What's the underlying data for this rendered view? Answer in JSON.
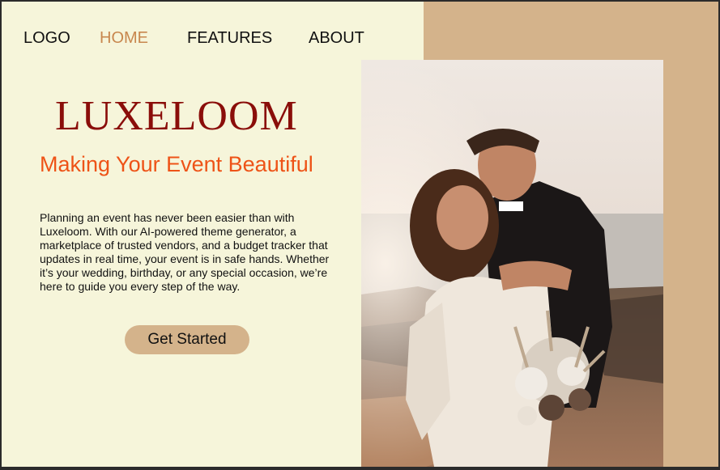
{
  "nav": {
    "logo": "LOGO",
    "items": [
      "HOME",
      "FEATURES",
      "ABOUT"
    ],
    "active": "HOME"
  },
  "hero": {
    "brand": "LUXELOOM",
    "tagline": "Making Your Event Beautiful",
    "description": "Planning an event has never been easier than with Luxeloom. With our AI-powered theme generator, a marketplace of trusted vendors, and a budget tracker that updates in real time, your event is in safe hands. Whether it’s your wedding, birthday, or any special occasion, we’re here to guide you every step of the way.",
    "cta_label": "Get Started"
  },
  "colors": {
    "background": "#f6f5da",
    "accent_panel": "#d4b38b",
    "brand": "#8a0e0a",
    "tagline": "#ee5317",
    "nav_active": "#c8874e"
  }
}
